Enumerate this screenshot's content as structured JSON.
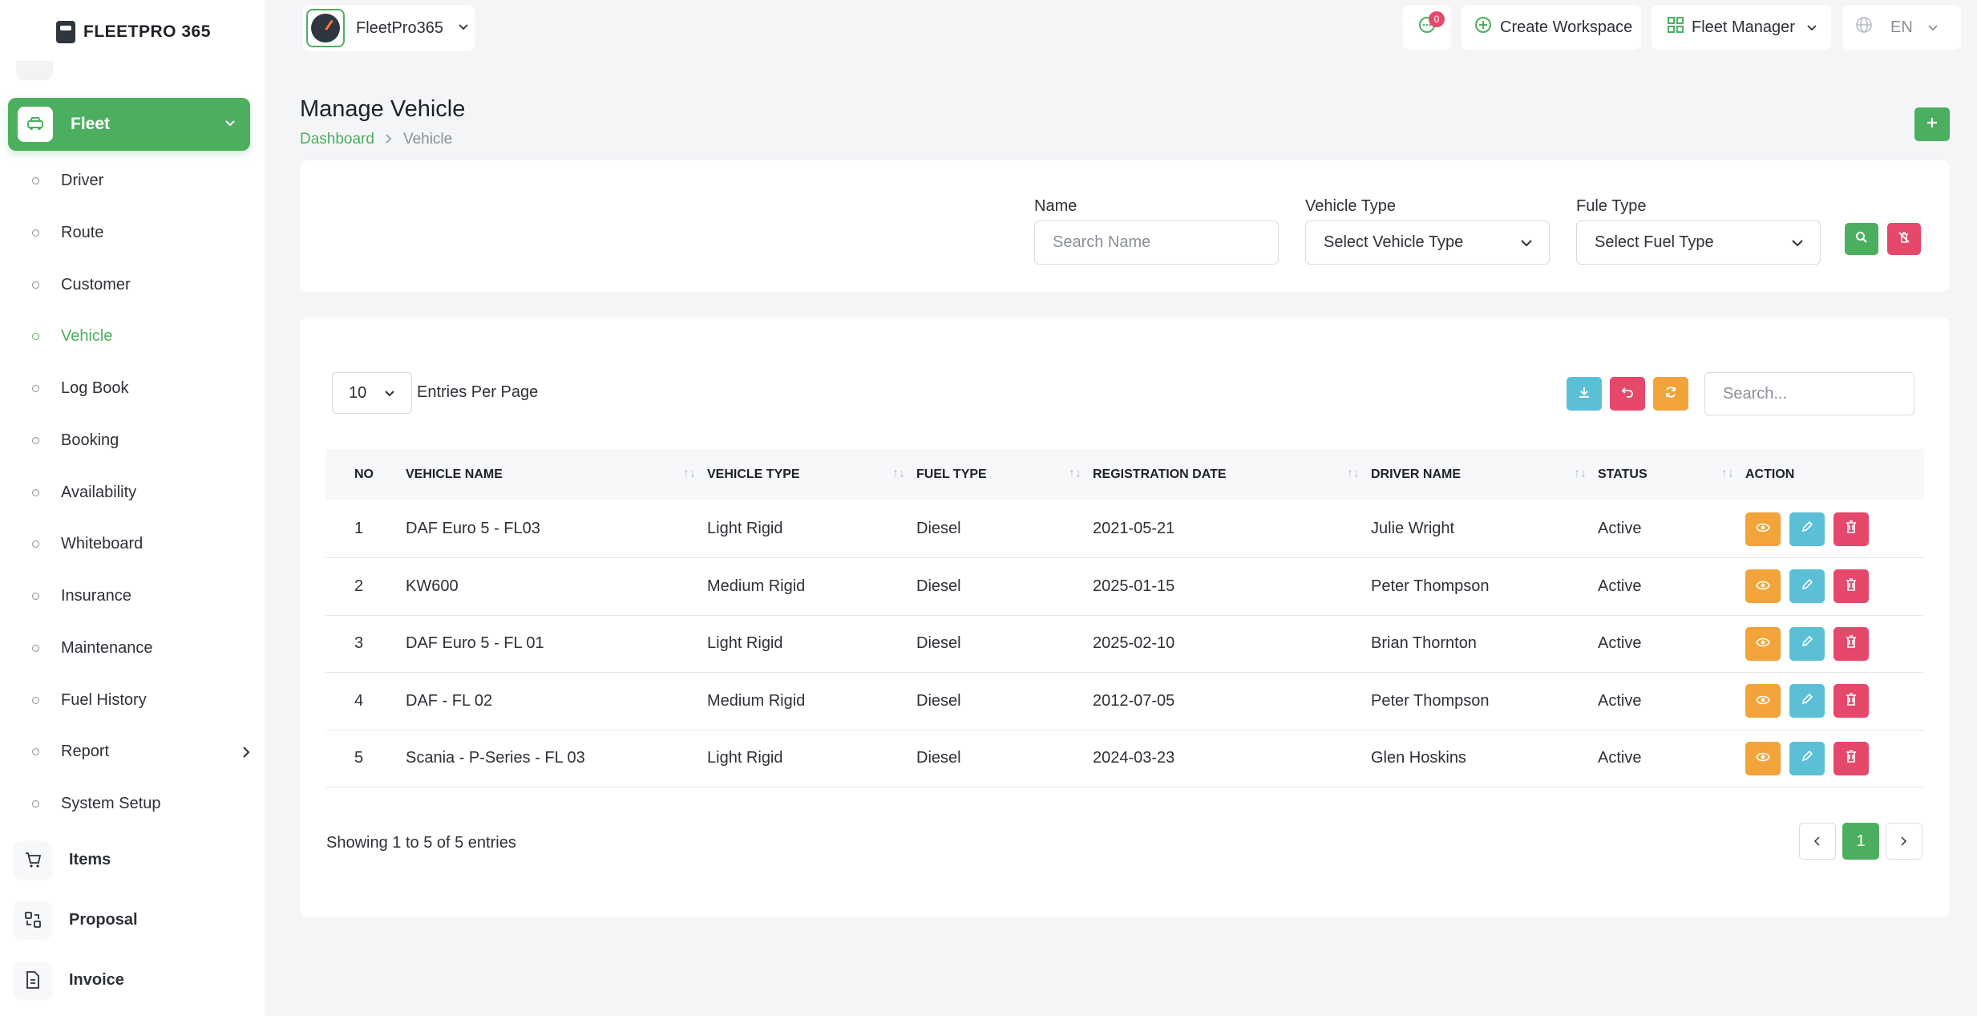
{
  "app": {
    "logo_text": "FLEETPRO 365",
    "workspace": "FleetPro365"
  },
  "topbar": {
    "messages_count": "0",
    "create_workspace": "Create Workspace",
    "role": "Fleet Manager",
    "language": "EN"
  },
  "sidebar": {
    "fleet": "Fleet",
    "items": [
      {
        "label": "Driver"
      },
      {
        "label": "Route"
      },
      {
        "label": "Customer"
      },
      {
        "label": "Vehicle"
      },
      {
        "label": "Log Book"
      },
      {
        "label": "Booking"
      },
      {
        "label": "Availability"
      },
      {
        "label": "Whiteboard"
      },
      {
        "label": "Insurance"
      },
      {
        "label": "Maintenance"
      },
      {
        "label": "Fuel History"
      },
      {
        "label": "Report"
      },
      {
        "label": "System Setup"
      }
    ],
    "main": [
      {
        "label": "Items"
      },
      {
        "label": "Proposal"
      },
      {
        "label": "Invoice"
      }
    ]
  },
  "page": {
    "title": "Manage Vehicle",
    "breadcrumb": {
      "home": "Dashboard",
      "current": "Vehicle"
    }
  },
  "filters": {
    "name_label": "Name",
    "name_placeholder": "Search Name",
    "vehicle_type_label": "Vehicle Type",
    "vehicle_type_value": "Select Vehicle Type",
    "fuel_type_label": "Fule Type",
    "fuel_type_value": "Select Fuel Type"
  },
  "table": {
    "per_page": "10",
    "per_page_label": "Entries Per Page",
    "search_placeholder": "Search...",
    "columns": [
      "NO",
      "VEHICLE NAME",
      "VEHICLE TYPE",
      "FUEL TYPE",
      "REGISTRATION DATE",
      "DRIVER NAME",
      "STATUS",
      "ACTION"
    ],
    "rows": [
      {
        "no": "1",
        "vehicle": "DAF Euro 5 - FL03",
        "type": "Light Rigid",
        "fuel": "Diesel",
        "date": "2021-05-21",
        "driver": "Julie Wright",
        "status": "Active"
      },
      {
        "no": "2",
        "vehicle": "KW600",
        "type": "Medium Rigid",
        "fuel": "Diesel",
        "date": "2025-01-15",
        "driver": "Peter Thompson",
        "status": "Active"
      },
      {
        "no": "3",
        "vehicle": "DAF Euro 5 - FL 01",
        "type": "Light Rigid",
        "fuel": "Diesel",
        "date": "2025-02-10",
        "driver": "Brian Thornton",
        "status": "Active"
      },
      {
        "no": "4",
        "vehicle": "DAF - FL 02",
        "type": "Medium Rigid",
        "fuel": "Diesel",
        "date": "2012-07-05",
        "driver": "Peter Thompson",
        "status": "Active"
      },
      {
        "no": "5",
        "vehicle": "Scania - P-Series - FL 03",
        "type": "Light Rigid",
        "fuel": "Diesel",
        "date": "2024-03-23",
        "driver": "Glen Hoskins",
        "status": "Active"
      }
    ],
    "showing": "Showing 1 to 5 of 5 entries",
    "page": "1"
  },
  "colors": {
    "accent": "#4caf5f",
    "info": "#5bc0d6",
    "danger": "#e5486b",
    "warning": "#f2a43a"
  }
}
